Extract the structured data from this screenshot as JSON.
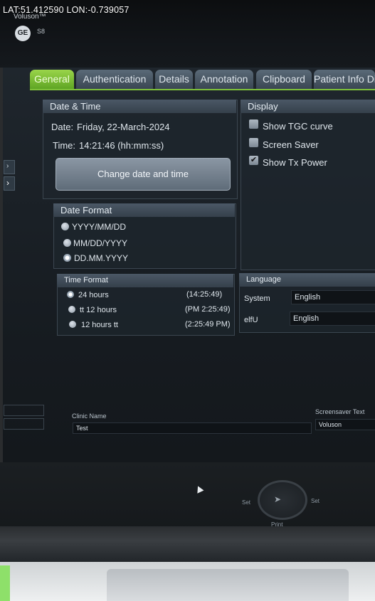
{
  "overlay": {
    "gps": "LAT:51.412590 LON:-0.739057"
  },
  "brand": {
    "product": "Voluson™",
    "model": "S8",
    "logo": "GE"
  },
  "tabs": [
    {
      "label": "General",
      "active": true
    },
    {
      "label": "Authentication"
    },
    {
      "label": "Details"
    },
    {
      "label": "Annotation"
    },
    {
      "label": "Clipboard"
    },
    {
      "label": "Patient Info Di"
    }
  ],
  "datetime": {
    "header": "Date & Time",
    "date_label": "Date:",
    "date_value": "Friday, 22-March-2024",
    "time_label": "Time:",
    "time_value": "14:21:46 (hh:mm:ss)",
    "change_button": "Change date and time"
  },
  "display": {
    "header": "Display",
    "options": [
      {
        "label": "Show TGC curve",
        "checked": false
      },
      {
        "label": "Screen Saver",
        "checked": false
      },
      {
        "label": "Show Tx Power",
        "checked": true
      }
    ]
  },
  "date_format": {
    "header": "Date Format",
    "options": [
      {
        "label": "YYYY/MM/DD",
        "selected": false
      },
      {
        "label": "MM/DD/YYYY",
        "selected": false
      },
      {
        "label": "DD.MM.YYYY",
        "selected": true
      }
    ]
  },
  "time_format": {
    "header": "Time Format",
    "options": [
      {
        "label": "24 hours",
        "example": "(14:25:49)",
        "selected": true
      },
      {
        "label": "tt 12 hours",
        "example": "(PM 2:25:49)",
        "selected": false
      },
      {
        "label": "12 hours tt",
        "example": "(2:25:49 PM)",
        "selected": false
      }
    ]
  },
  "language": {
    "header": "Language",
    "system_label": "System",
    "system_value": "English",
    "elfu_label": "elfU",
    "elfu_value": "English"
  },
  "clinic": {
    "label": "Clinic Name",
    "value": "Test"
  },
  "screensaver": {
    "label": "Screensaver Text",
    "value": "Voluson"
  },
  "panel_controls": {
    "set_left": "Set",
    "set_right": "Set",
    "print": "Print"
  },
  "colors": {
    "active_tab": "#7fc23a",
    "tab": "#4a5866",
    "screen_bg": "#1a2026"
  }
}
